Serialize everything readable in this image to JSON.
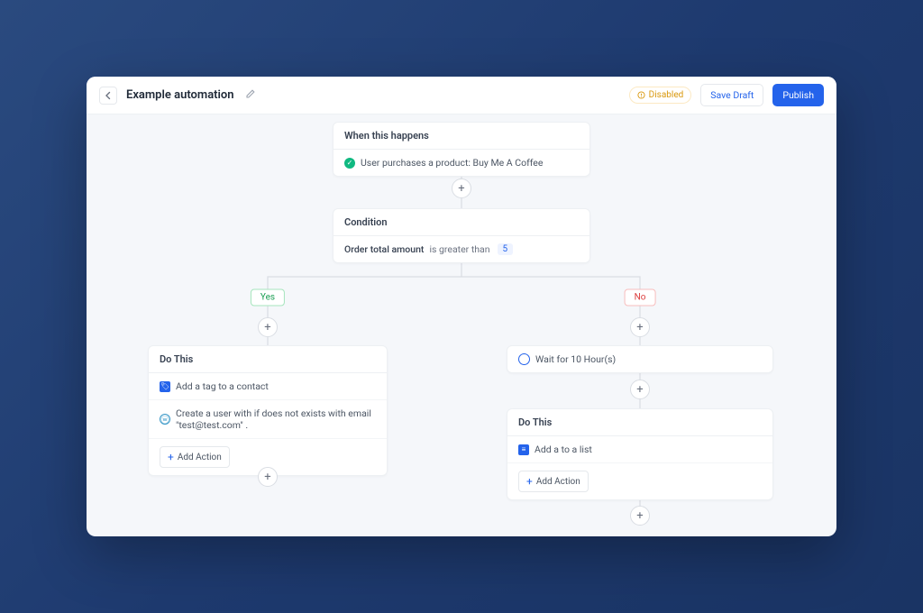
{
  "header": {
    "title": "Example automation",
    "status": "Disabled",
    "save_draft": "Save Draft",
    "publish": "Publish"
  },
  "trigger": {
    "title": "When this happens",
    "text": "User purchases a product: Buy Me A Coffee"
  },
  "condition": {
    "title": "Condition",
    "field": "Order total amount",
    "op": "is greater than",
    "value": "5"
  },
  "branches": {
    "yes_label": "Yes",
    "no_label": "No"
  },
  "yes_block": {
    "title": "Do This",
    "action1": "Add a tag to a contact",
    "action2": "Create a user with if does not exists with email \"test@test.com\" .",
    "add": "Add Action"
  },
  "no_wait": {
    "text": "Wait for 10 Hour(s)"
  },
  "no_block": {
    "title": "Do This",
    "action1": "Add a to a list",
    "add": "Add Action"
  }
}
